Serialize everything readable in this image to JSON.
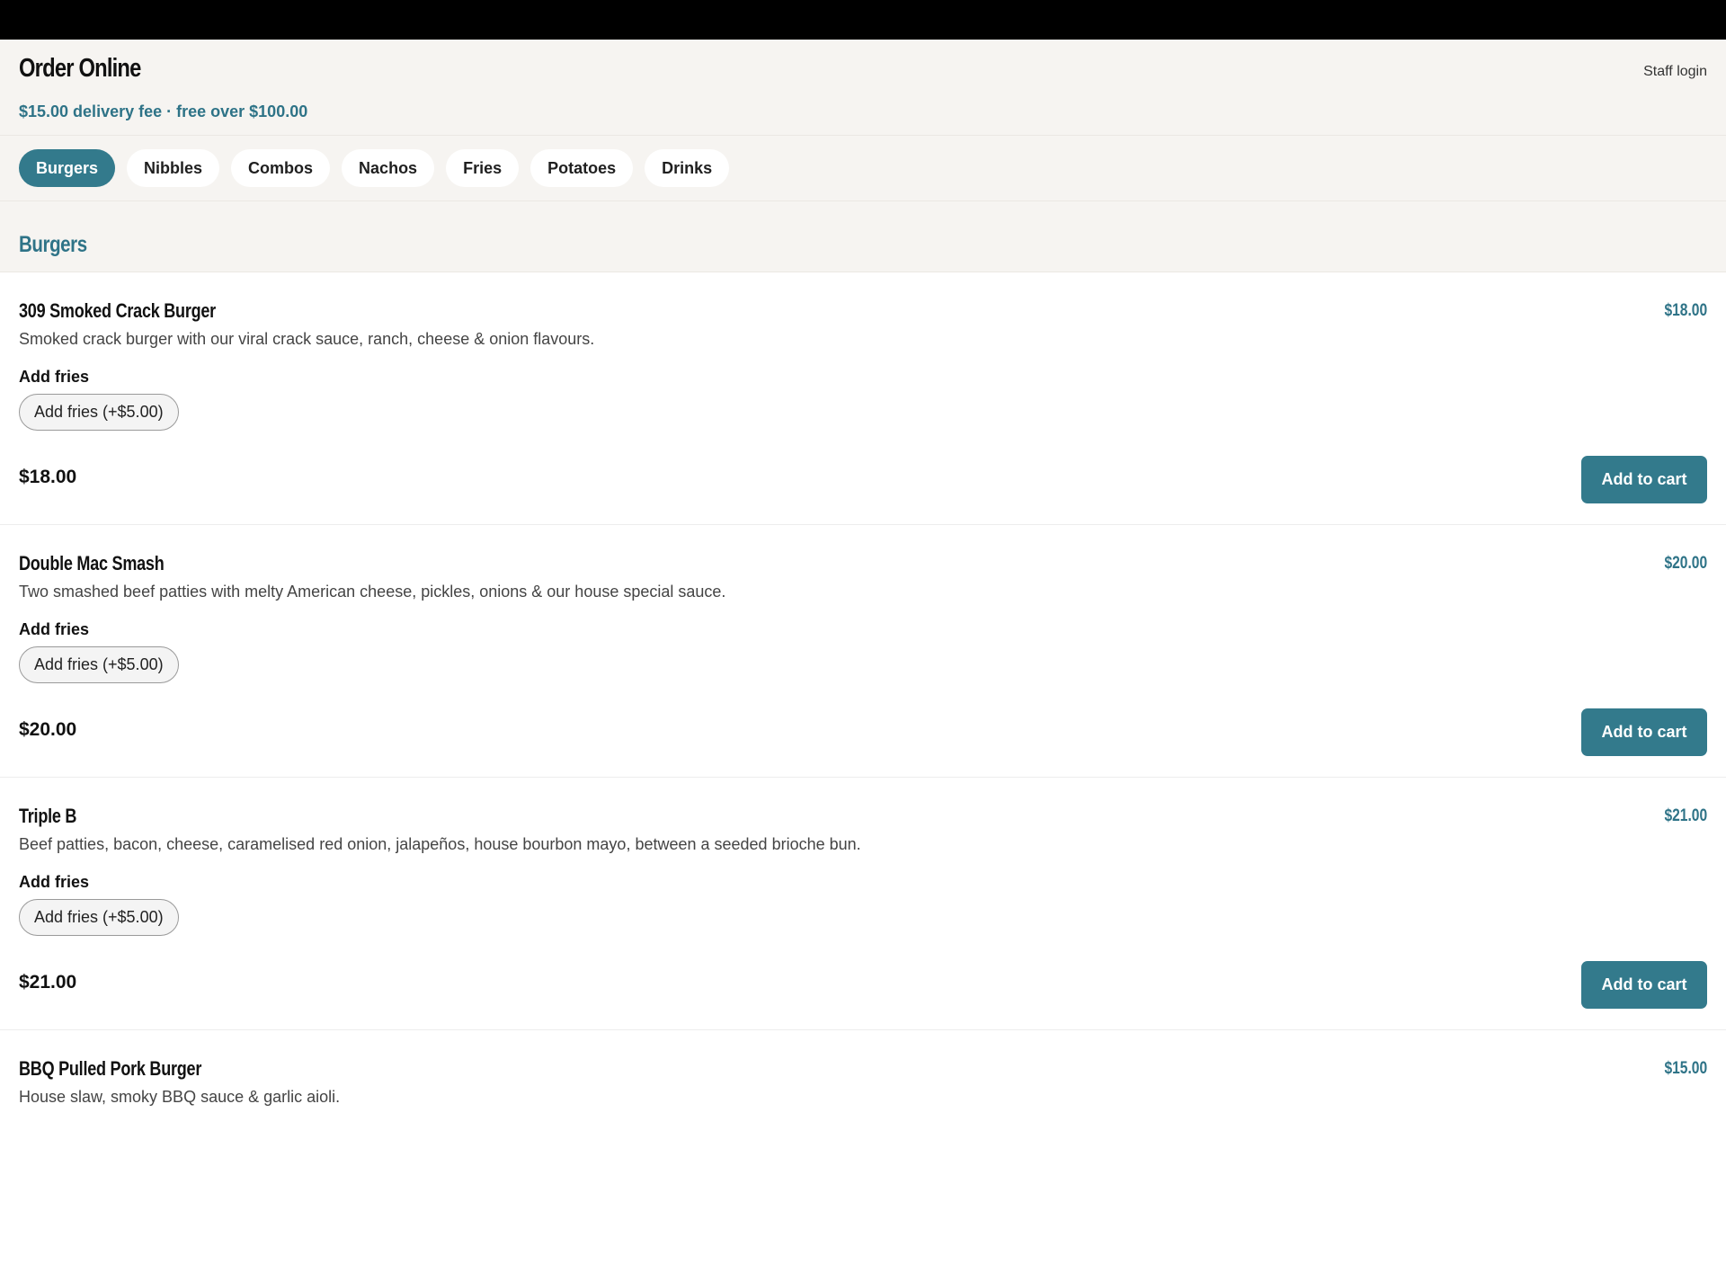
{
  "header": {
    "title": "Order Online",
    "subtitle": "$15.00 delivery fee · free over $100.00",
    "staff_login": "Staff login"
  },
  "tabs": [
    {
      "label": "Burgers",
      "active": true
    },
    {
      "label": "Nibbles",
      "active": false
    },
    {
      "label": "Combos",
      "active": false
    },
    {
      "label": "Nachos",
      "active": false
    },
    {
      "label": "Fries",
      "active": false
    },
    {
      "label": "Potatoes",
      "active": false
    },
    {
      "label": "Drinks",
      "active": false
    }
  ],
  "section": {
    "label": "Burgers"
  },
  "items": [
    {
      "name": "309 Smoked Crack Burger",
      "price": "$18.00",
      "description": "Smoked crack burger with our viral crack sauce, ranch, cheese & onion flavours.",
      "option_label": "Add fries",
      "option_pill": "Add fries (+$5.00)",
      "total": "$18.00",
      "cart_label": "Add to cart"
    },
    {
      "name": "Double Mac Smash",
      "price": "$20.00",
      "description": "Two smashed beef patties with melty American cheese, pickles, onions & our house special sauce.",
      "option_label": "Add fries",
      "option_pill": "Add fries (+$5.00)",
      "total": "$20.00",
      "cart_label": "Add to cart"
    },
    {
      "name": "Triple B",
      "price": "$21.00",
      "description": "Beef patties, bacon, cheese, caramelised red onion, jalapeños, house bourbon mayo, between a seeded brioche bun.",
      "option_label": "Add fries",
      "option_pill": "Add fries (+$5.00)",
      "total": "$21.00",
      "cart_label": "Add to cart"
    },
    {
      "name": "BBQ Pulled Pork Burger",
      "price": "$15.00",
      "description": "House slaw, smoky BBQ sauce & garlic aioli."
    }
  ],
  "colors": {
    "accent": "#337a8c",
    "accent_text": "#2e7387",
    "header_bg": "#f6f4f1"
  }
}
